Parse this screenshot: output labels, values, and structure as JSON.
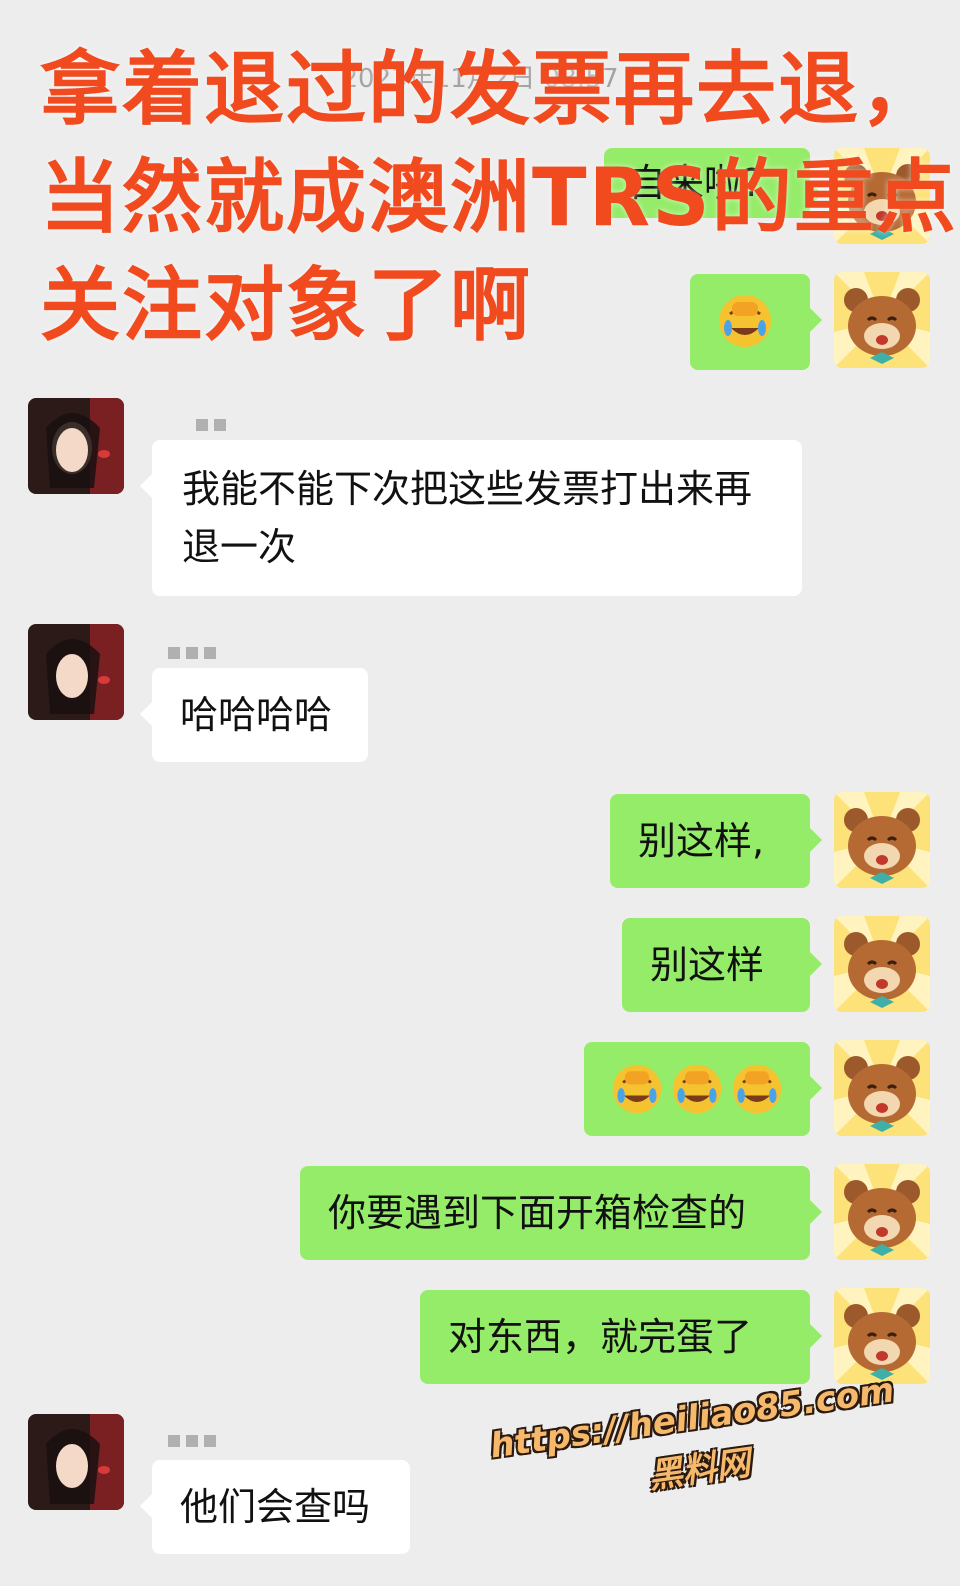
{
  "chat": {
    "timestamp": "2023年11月2日 08:57",
    "messages": [
      {
        "side": "right",
        "text": "自来啦?"
      },
      {
        "side": "right",
        "emoji": [
          "facepalm-laugh-emoji"
        ]
      },
      {
        "side": "left",
        "text": "我能不能下次把这些发票打出来再退一次"
      },
      {
        "side": "left",
        "text": "哈哈哈哈"
      },
      {
        "side": "right",
        "text": "别这样,"
      },
      {
        "side": "right",
        "text": "别这样"
      },
      {
        "side": "right",
        "emoji": [
          "facepalm-laugh-emoji",
          "facepalm-laugh-emoji",
          "facepalm-laugh-emoji"
        ]
      },
      {
        "side": "right",
        "text": "你要遇到下面开箱检查的"
      },
      {
        "side": "right",
        "text": "对东西，就完蛋了"
      },
      {
        "side": "left",
        "text": "他们会查吗"
      }
    ]
  },
  "overlay": {
    "caption": "拿着退过的发票再去退，当然就成澳洲TRS的重点关注对象了啊"
  },
  "watermark": {
    "url": "https://heiliao85.com",
    "site_name": "黑料网"
  },
  "colors": {
    "background": "#ededed",
    "bubble_self": "#95ec69",
    "bubble_other": "#ffffff",
    "caption": "#f04a1e",
    "watermark": "#f6b86a"
  }
}
